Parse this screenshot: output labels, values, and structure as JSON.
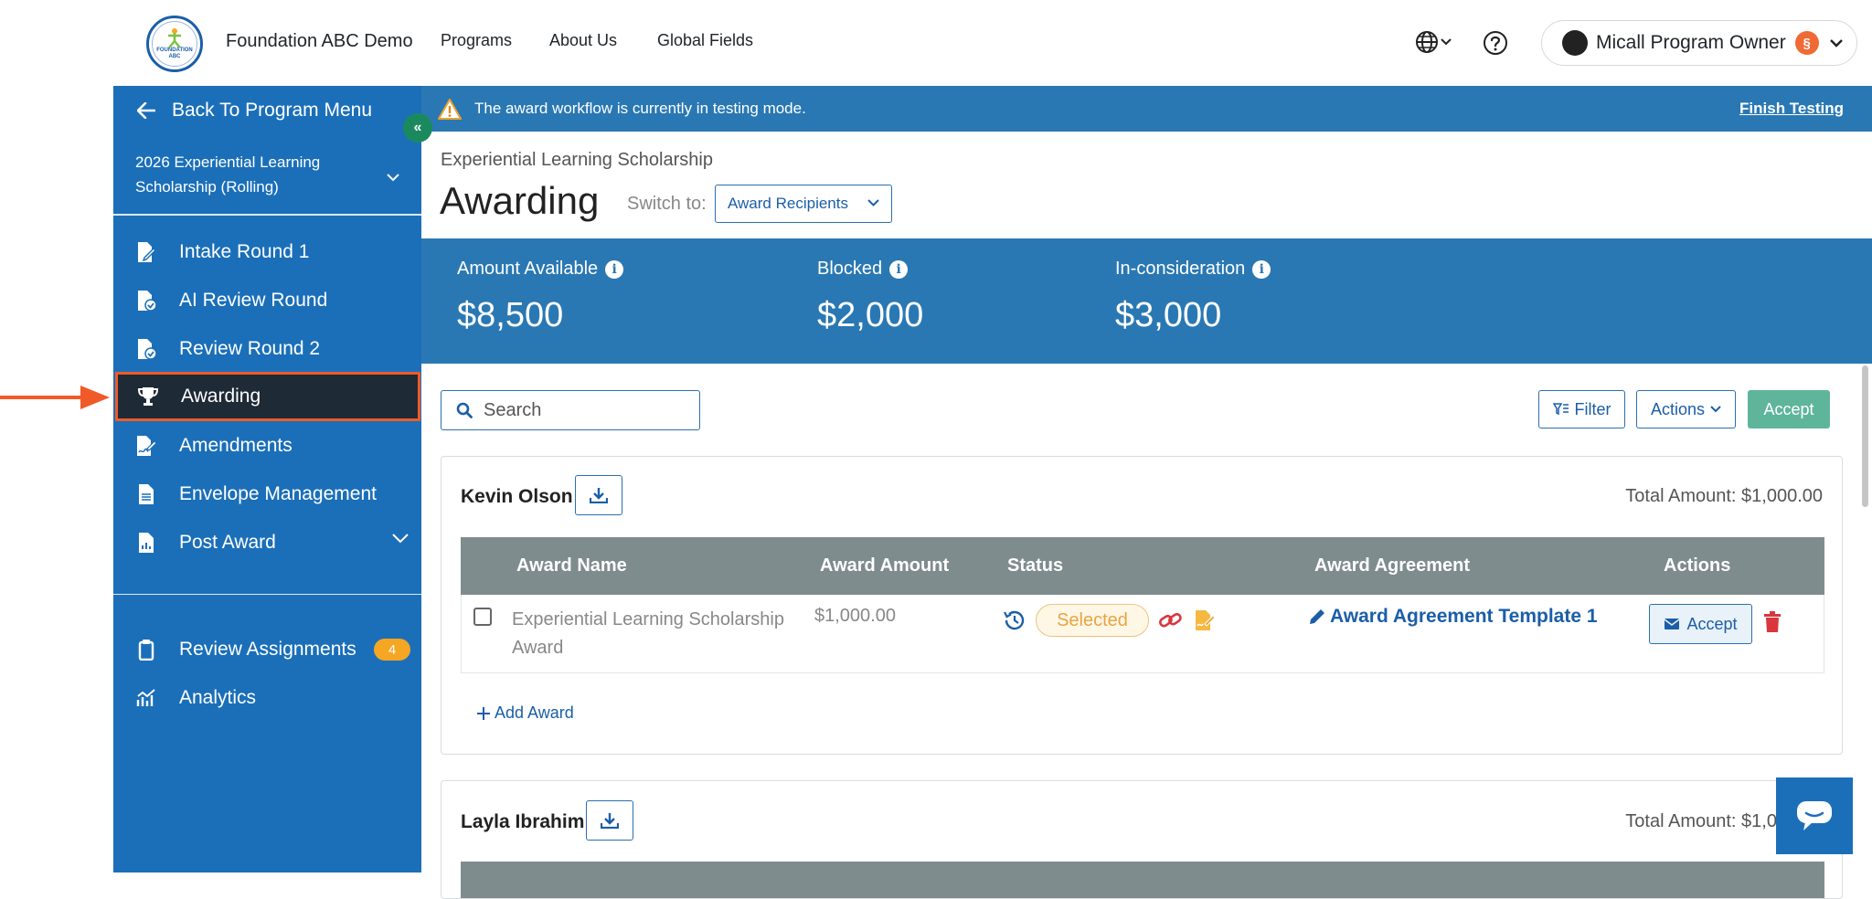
{
  "header": {
    "org_name": "Foundation ABC Demo",
    "logo_text": "FOUNDATION ABC",
    "nav": [
      "Programs",
      "About Us",
      "Global Fields"
    ],
    "user_name": "Micall Program Owner",
    "user_badge": "§"
  },
  "sidebar": {
    "back_label": "Back To Program Menu",
    "program_name": "2026 Experiential Learning Scholarship (Rolling)",
    "items": [
      {
        "label": "Intake Round 1",
        "icon": "file-edit-icon"
      },
      {
        "label": "AI Review Round",
        "icon": "file-check-icon"
      },
      {
        "label": "Review Round 2",
        "icon": "file-check-icon"
      },
      {
        "label": "Awarding",
        "icon": "trophy-icon",
        "active": true
      },
      {
        "label": "Amendments",
        "icon": "file-signature-icon"
      },
      {
        "label": "Envelope Management",
        "icon": "document-icon"
      },
      {
        "label": "Post Award",
        "icon": "file-chart-icon"
      }
    ],
    "bottom_items": [
      {
        "label": "Review Assignments",
        "icon": "clipboard-icon",
        "count": "4"
      },
      {
        "label": "Analytics",
        "icon": "analytics-icon"
      }
    ],
    "active_color": "#1f2a37",
    "highlight_color": "#f05a28"
  },
  "banner": {
    "message": "The award workflow is currently in testing mode.",
    "action": "Finish Testing"
  },
  "page": {
    "breadcrumb": "Experiential Learning Scholarship",
    "title": "Awarding",
    "switch_label": "Switch to:",
    "switch_value": "Award Recipients"
  },
  "stats": [
    {
      "label": "Amount Available",
      "value": "$8,500"
    },
    {
      "label": "Blocked",
      "value": "$2,000"
    },
    {
      "label": "In-consideration",
      "value": "$3,000"
    }
  ],
  "toolbar": {
    "search_placeholder": "Search",
    "filter_label": "Filter",
    "actions_label": "Actions",
    "accept_label": "Accept"
  },
  "table_headers": [
    "Award Name",
    "Award Amount",
    "Status",
    "Award Agreement",
    "Actions"
  ],
  "recipients": [
    {
      "name": "Kevin Olson",
      "total": "Total Amount: $1,000.00",
      "awards": [
        {
          "name": "Experiential Learning Scholarship Award",
          "amount": "$1,000.00",
          "status": "Selected",
          "agreement": "Award Agreement Template 1",
          "accept_label": "Accept"
        }
      ],
      "add_award_label": "Add Award"
    },
    {
      "name": "Layla Ibrahim",
      "total": "Total Amount: $1,000.00"
    }
  ],
  "colors": {
    "primary": "#1b6fb9",
    "banner": "#2a78b3",
    "accept_green": "#5fb59a",
    "status_selected": "#e8a440",
    "badge_orange": "#f5a623"
  }
}
